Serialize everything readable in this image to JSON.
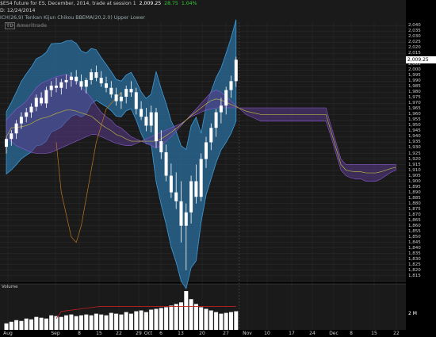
{
  "header": {
    "symbol_line": "$ES4 future for ES, December, 2014, trade at session 1",
    "price": "2,009.25",
    "change": "28.75",
    "change_pct": "1.04%",
    "period_line": "D: 12/24/2014",
    "indicator_line": "ICH(26,9) Tenkan  Kijun  Chikou   BBEMA(20,2.0)  Upper  Lower"
  },
  "watermark": "Ameritrade",
  "volume_label": "Volume",
  "last_price_label": "2,009.25",
  "volume_scale": {
    "max_label": "2 M"
  },
  "y_axis_labels": [
    "2,040",
    "2,035",
    "2,030",
    "2,025",
    "2,020",
    "2,015",
    "2,010",
    "2,005",
    "2,000",
    "1,995",
    "1,990",
    "1,985",
    "1,980",
    "1,975",
    "1,970",
    "1,965",
    "1,960",
    "1,955",
    "1,950",
    "1,945",
    "1,940",
    "1,935",
    "1,930",
    "1,925",
    "1,920",
    "1,915",
    "1,910",
    "1,905",
    "1,900",
    "1,895",
    "1,890",
    "1,885",
    "1,880",
    "1,875",
    "1,870",
    "1,865",
    "1,860",
    "1,855",
    "1,850",
    "1,845",
    "1,840",
    "1,835",
    "1,830",
    "1,825",
    "1,820",
    "1,815"
  ],
  "x_axis_labels": [
    "Aug",
    "Sep",
    "8",
    "15",
    "22",
    "29",
    "Oct",
    "6",
    "13",
    "20",
    "27",
    "Nov",
    "10",
    "17",
    "24",
    "Dec",
    "8",
    "15",
    "22"
  ],
  "chart_data": {
    "type": "candlestick",
    "ylim": [
      1812,
      2043
    ],
    "candles": [
      [
        1931,
        1940,
        1925,
        1938
      ],
      [
        1938,
        1946,
        1932,
        1943
      ],
      [
        1943,
        1955,
        1938,
        1952
      ],
      [
        1952,
        1962,
        1947,
        1958
      ],
      [
        1958,
        1966,
        1953,
        1962
      ],
      [
        1962,
        1970,
        1957,
        1967
      ],
      [
        1967,
        1978,
        1963,
        1975
      ],
      [
        1975,
        1980,
        1968,
        1970
      ],
      [
        1970,
        1985,
        1966,
        1982
      ],
      [
        1982,
        1990,
        1976,
        1986
      ],
      [
        1986,
        1993,
        1980,
        1984
      ],
      [
        1984,
        1992,
        1978,
        1989
      ],
      [
        1989,
        1996,
        1983,
        1991
      ],
      [
        1991,
        1998,
        1985,
        1994
      ],
      [
        1994,
        2000,
        1987,
        1990
      ],
      [
        1990,
        1996,
        1982,
        1985
      ],
      [
        1985,
        1993,
        1979,
        1991
      ],
      [
        1991,
        2001,
        1987,
        1998
      ],
      [
        1998,
        2004,
        1990,
        1993
      ],
      [
        1993,
        1999,
        1985,
        1988
      ],
      [
        1988,
        1994,
        1980,
        1984
      ],
      [
        1984,
        1990,
        1975,
        1978
      ],
      [
        1978,
        1984,
        1968,
        1972
      ],
      [
        1972,
        1980,
        1965,
        1976
      ],
      [
        1976,
        1986,
        1970,
        1983
      ],
      [
        1983,
        1990,
        1976,
        1980
      ],
      [
        1980,
        1984,
        1960,
        1965
      ],
      [
        1965,
        1972,
        1955,
        1958
      ],
      [
        1958,
        1966,
        1945,
        1950
      ],
      [
        1950,
        1968,
        1944,
        1962
      ],
      [
        1962,
        1966,
        1930,
        1936
      ],
      [
        1936,
        1946,
        1920,
        1926
      ],
      [
        1926,
        1933,
        1900,
        1905
      ],
      [
        1905,
        1916,
        1885,
        1890
      ],
      [
        1890,
        1908,
        1875,
        1882
      ],
      [
        1882,
        1900,
        1845,
        1860
      ],
      [
        1860,
        1880,
        1820,
        1872
      ],
      [
        1872,
        1905,
        1862,
        1900
      ],
      [
        1900,
        1915,
        1880,
        1886
      ],
      [
        1886,
        1925,
        1882,
        1920
      ],
      [
        1920,
        1940,
        1912,
        1935
      ],
      [
        1935,
        1952,
        1928,
        1948
      ],
      [
        1948,
        1965,
        1940,
        1962
      ],
      [
        1962,
        1975,
        1952,
        1968
      ],
      [
        1968,
        1985,
        1960,
        1982
      ],
      [
        1982,
        1995,
        1975,
        1990
      ],
      [
        1990,
        2012,
        1985,
        2009.25
      ]
    ],
    "volume": [
      0.4,
      0.5,
      0.6,
      0.55,
      0.7,
      0.65,
      0.8,
      0.75,
      0.7,
      0.9,
      0.85,
      0.8,
      0.9,
      0.95,
      0.85,
      0.9,
      0.95,
      0.9,
      1.0,
      0.95,
      0.9,
      1.05,
      1.0,
      0.95,
      1.1,
      1.0,
      1.15,
      1.2,
      1.1,
      1.25,
      1.3,
      1.35,
      1.4,
      1.5,
      1.6,
      1.7,
      2.4,
      1.9,
      1.6,
      1.4,
      1.3,
      1.2,
      1.1,
      1.0,
      1.05,
      1.1,
      1.15
    ],
    "volume_max": 2.5,
    "cloud_upper": [
      1955,
      1960,
      1965,
      1968,
      1972,
      1978,
      1984,
      1988,
      1990,
      1992,
      1994,
      1995,
      1996,
      1994,
      1990,
      1985,
      1980,
      1975,
      1968,
      1962,
      1958,
      1955,
      1950,
      1948,
      1944,
      1940,
      1938,
      1936,
      1934,
      1932,
      1930,
      1932,
      1936,
      1940,
      1945,
      1950,
      1955,
      1958,
      1960,
      1962,
      1964,
      1965,
      1966,
      1966,
      1966,
      1966,
      1966,
      1966,
      1966,
      1966,
      1966,
      1966,
      1966,
      1966,
      1966,
      1966,
      1966,
      1966,
      1966,
      1966,
      1966,
      1966,
      1966,
      1966,
      1966,
      1950,
      1935,
      1920,
      1915,
      1915,
      1915,
      1915,
      1915,
      1915,
      1915,
      1915,
      1915,
      1915,
      1915
    ],
    "cloud_lower": [
      1938,
      1936,
      1932,
      1930,
      1928,
      1926,
      1925,
      1925,
      1925,
      1926,
      1928,
      1930,
      1932,
      1934,
      1936,
      1938,
      1940,
      1942,
      1942,
      1940,
      1938,
      1936,
      1934,
      1933,
      1932,
      1932,
      1934,
      1936,
      1938,
      1940,
      1942,
      1944,
      1946,
      1948,
      1950,
      1952,
      1955,
      1960,
      1965,
      1970,
      1975,
      1980,
      1982,
      1980,
      1976,
      1972,
      1968,
      1964,
      1960,
      1958,
      1956,
      1954,
      1954,
      1954,
      1954,
      1954,
      1954,
      1954,
      1954,
      1954,
      1954,
      1954,
      1954,
      1954,
      1954,
      1940,
      1925,
      1910,
      1905,
      1903,
      1902,
      1902,
      1900,
      1900,
      1900,
      1902,
      1905,
      1908,
      1910
    ]
  }
}
